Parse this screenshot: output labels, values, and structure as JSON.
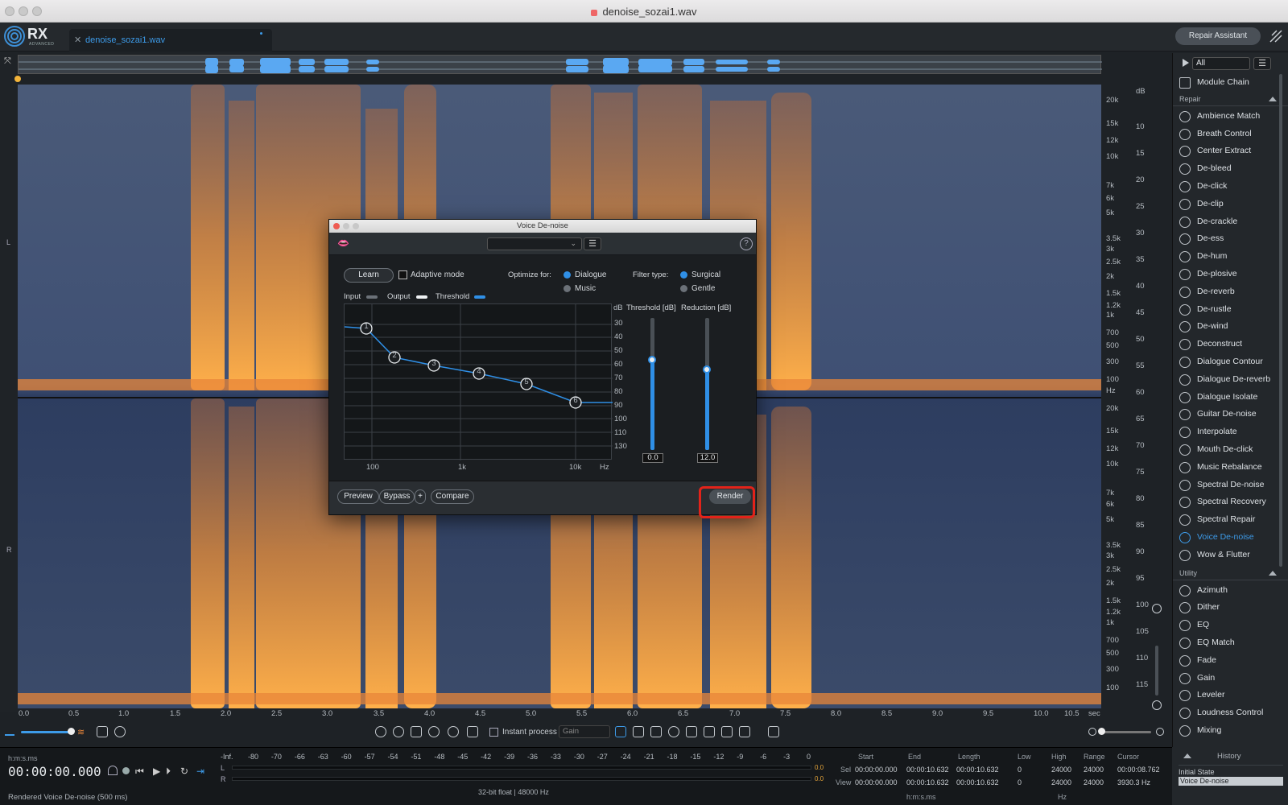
{
  "window": {
    "title": "denoise_sozai1.wav"
  },
  "app": {
    "logo": "RX",
    "logo_sub": "ADVANCED",
    "file_tab": "denoise_sozai1.wav",
    "repair_assistant": "Repair Assistant"
  },
  "channels": {
    "left": "L",
    "right": "R"
  },
  "freq_labels_top": [
    "20k",
    "15k",
    "12k",
    "10k",
    "7k",
    "6k",
    "5k",
    "3.5k",
    "3k",
    "2.5k",
    "2k",
    "1.5k",
    "1.2k",
    "1k",
    "700",
    "500",
    "300",
    "100",
    "Hz"
  ],
  "freq_labels_bottom": [
    "20k",
    "15k",
    "12k",
    "10k",
    "7k",
    "6k",
    "5k",
    "3.5k",
    "3k",
    "2.5k",
    "2k",
    "1.5k",
    "1.2k",
    "1k",
    "700",
    "500",
    "300",
    "100"
  ],
  "db_labels": [
    "dB",
    "10",
    "15",
    "20",
    "25",
    "30",
    "35",
    "40",
    "45",
    "50",
    "55",
    "60",
    "65",
    "70",
    "75",
    "80",
    "85",
    "90",
    "95",
    "100",
    "105",
    "110",
    "115"
  ],
  "time_labels": [
    "0.0",
    "0.5",
    "1.0",
    "1.5",
    "2.0",
    "2.5",
    "3.0",
    "3.5",
    "4.0",
    "4.5",
    "5.0",
    "5.5",
    "6.0",
    "6.5",
    "7.0",
    "7.5",
    "8.0",
    "8.5",
    "9.0",
    "9.5",
    "10.0",
    "10.5",
    "sec"
  ],
  "sidebar": {
    "filter": "All",
    "module_chain": "Module Chain",
    "repair_header": "Repair",
    "repair": [
      "Ambience Match",
      "Breath Control",
      "Center Extract",
      "De-bleed",
      "De-click",
      "De-clip",
      "De-crackle",
      "De-ess",
      "De-hum",
      "De-plosive",
      "De-reverb",
      "De-rustle",
      "De-wind",
      "Deconstruct",
      "Dialogue Contour",
      "Dialogue De-reverb",
      "Dialogue Isolate",
      "Guitar De-noise",
      "Interpolate",
      "Mouth De-click",
      "Music Rebalance",
      "Spectral De-noise",
      "Spectral Recovery",
      "Spectral Repair",
      "Voice De-noise",
      "Wow & Flutter"
    ],
    "utility_header": "Utility",
    "utility": [
      "Azimuth",
      "Dither",
      "EQ",
      "EQ Match",
      "Fade",
      "Gain",
      "Leveler",
      "Loudness Control",
      "Mixing"
    ],
    "active": "Voice De-noise"
  },
  "toolbar": {
    "instant_process": "Instant process",
    "gain_mode": "Gain"
  },
  "dialog": {
    "title": "Voice De-noise",
    "learn": "Learn",
    "adaptive_mode": "Adaptive mode",
    "optimize_for": "Optimize for:",
    "dialogue": "Dialogue",
    "music": "Music",
    "filter_type": "Filter type:",
    "surgical": "Surgical",
    "gentle": "Gentle",
    "legend_input": "Input",
    "legend_output": "Output",
    "legend_threshold": "Threshold",
    "graph_db_unit": "dB",
    "graph_db_ticks": [
      "30",
      "40",
      "50",
      "60",
      "70",
      "80",
      "90",
      "100",
      "110",
      "130"
    ],
    "graph_x_ticks": [
      "100",
      "1k",
      "10k",
      "Hz"
    ],
    "nodes": [
      "1",
      "2",
      "3",
      "4",
      "5",
      "6"
    ],
    "threshold_label": "Threshold [dB]",
    "reduction_label": "Reduction [dB]",
    "threshold_value": "0.0",
    "reduction_value": "12.0",
    "threshold_level": 0.68,
    "reduction_level": 0.61,
    "preview": "Preview",
    "bypass": "Bypass",
    "plus": "+",
    "compare": "Compare",
    "render": "Render",
    "help": "?"
  },
  "transport": {
    "format_label": "h:m:s.ms",
    "timecode": "00:00:00.000",
    "status": "Rendered Voice De-noise (500 ms)"
  },
  "meter": {
    "scale": [
      "-Inf.",
      "-80",
      "-70",
      "-66",
      "-63",
      "-60",
      "-57",
      "-54",
      "-51",
      "-48",
      "-45",
      "-42",
      "-39",
      "-36",
      "-33",
      "-30",
      "-27",
      "-24",
      "-21",
      "-18",
      "-15",
      "-12",
      "-9",
      "-6",
      "-3",
      "0"
    ],
    "l": "L",
    "r": "R",
    "peak_l": "0.0",
    "peak_r": "0.0",
    "format": "32-bit float | 48000 Hz"
  },
  "selection": {
    "headers": [
      "Start",
      "End",
      "Length",
      "Low",
      "High",
      "Range",
      "Cursor"
    ],
    "sel_label": "Sel",
    "view_label": "View",
    "sel": [
      "00:00:00.000",
      "00:00:10.632",
      "00:00:10.632",
      "0",
      "24000",
      "24000",
      "00:00:08.762"
    ],
    "view": [
      "00:00:00.000",
      "00:00:10.632",
      "00:00:10.632",
      "0",
      "24000",
      "24000",
      "3930.3 Hz"
    ],
    "unit_time": "h:m:s.ms",
    "unit_hz": "Hz"
  },
  "history": {
    "title": "History",
    "items": [
      "Initial State",
      "Voice De-noise"
    ]
  }
}
